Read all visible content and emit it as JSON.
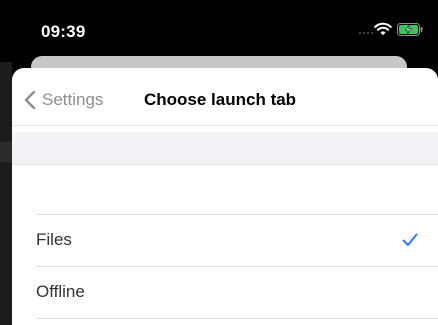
{
  "status_bar": {
    "time": "09:39"
  },
  "nav": {
    "back_label": "Settings",
    "title": "Choose launch tab"
  },
  "options": [
    {
      "label": "Files",
      "selected": true
    },
    {
      "label": "Offline",
      "selected": false
    }
  ],
  "colors": {
    "accent": "#3478f6",
    "battery": "#34c759",
    "secondary_text": "#8e8e93"
  },
  "icons": {
    "back": "chevron-left-icon",
    "check": "checkmark-icon",
    "wifi": "wifi-icon",
    "battery": "battery-charging-icon"
  }
}
